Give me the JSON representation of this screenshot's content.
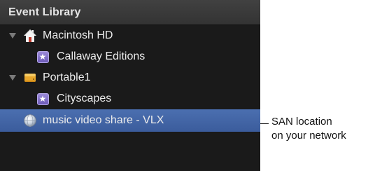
{
  "panel": {
    "title": "Event Library"
  },
  "tree": {
    "items": [
      {
        "label": "Macintosh HD",
        "icon": "home-drive-icon",
        "expanded": true
      },
      {
        "label": "Callaway Editions",
        "icon": "event-star-icon"
      },
      {
        "label": "Portable1",
        "icon": "external-drive-icon",
        "expanded": true
      },
      {
        "label": "Cityscapes",
        "icon": "event-star-icon"
      },
      {
        "label": "music video share - VLX",
        "icon": "san-globe-icon",
        "selected": true
      }
    ]
  },
  "callout": {
    "line1": "SAN location",
    "line2": "on your network"
  },
  "colors": {
    "panel_bg": "#1a1a1a",
    "selection": "#4465a6",
    "event_icon": "#7f6cc6"
  }
}
